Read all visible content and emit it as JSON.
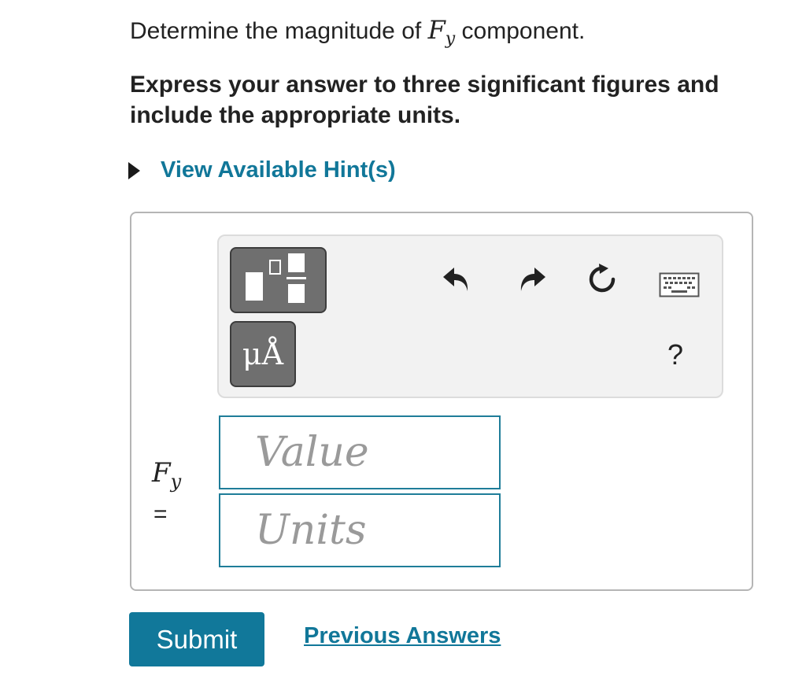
{
  "question": {
    "prefix": "Determine the magnitude of",
    "symbol": "F",
    "subscript": "y",
    "suffix": "component."
  },
  "instruction": "Express your answer to three significant figures and include the appropriate units.",
  "hint": {
    "label": "View Available Hint(s)"
  },
  "toolbar": {
    "units_symbol": "μÅ",
    "help": "?",
    "icons": [
      "templates-icon",
      "units-icon",
      "undo-icon",
      "redo-icon",
      "reset-icon",
      "keyboard-icon",
      "help-icon"
    ]
  },
  "answer": {
    "variable": "F",
    "variable_subscript": "y",
    "equals": "=",
    "value_placeholder": "Value",
    "units_placeholder": "Units",
    "value": "",
    "units": ""
  },
  "actions": {
    "submit": "Submit",
    "previous_answers": "Previous Answers"
  },
  "colors": {
    "accent": "#11789a",
    "link": "#117799",
    "field_border": "#1f7d99"
  }
}
